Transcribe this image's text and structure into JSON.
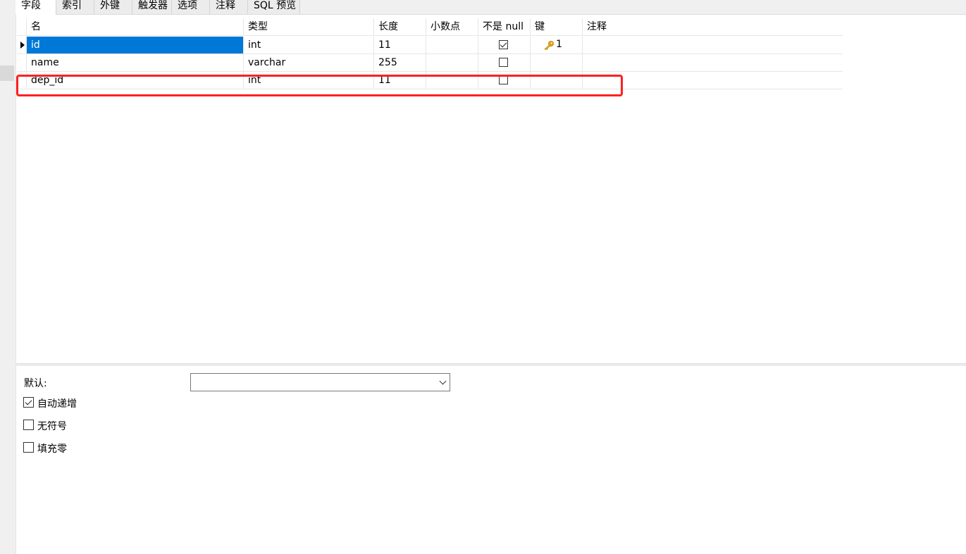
{
  "tabs": [
    "字段",
    "索引",
    "外键",
    "触发器",
    "选项",
    "注释",
    "SQL 预览"
  ],
  "columns": [
    "名",
    "类型",
    "长度",
    "小数点",
    "不是 null",
    "键",
    "注释"
  ],
  "rows": [
    {
      "name": "id",
      "type": "int",
      "length": "11",
      "decimals": "",
      "not_null": true,
      "key": "1",
      "comment": ""
    },
    {
      "name": "name",
      "type": "varchar",
      "length": "255",
      "decimals": "",
      "not_null": false,
      "key": "",
      "comment": ""
    },
    {
      "name": "dep_id",
      "type": "int",
      "length": "11",
      "decimals": "",
      "not_null": false,
      "key": "",
      "comment": ""
    }
  ],
  "properties": {
    "default_label": "默认:",
    "default_value": "",
    "auto_increment_label": "自动递增",
    "auto_increment": true,
    "unsigned_label": "无符号",
    "unsigned": false,
    "zerofill_label": "填充零",
    "zerofill": false
  },
  "colors": {
    "selection": "#0078d7",
    "highlight": "#ff2020",
    "key": "#e8a317"
  }
}
